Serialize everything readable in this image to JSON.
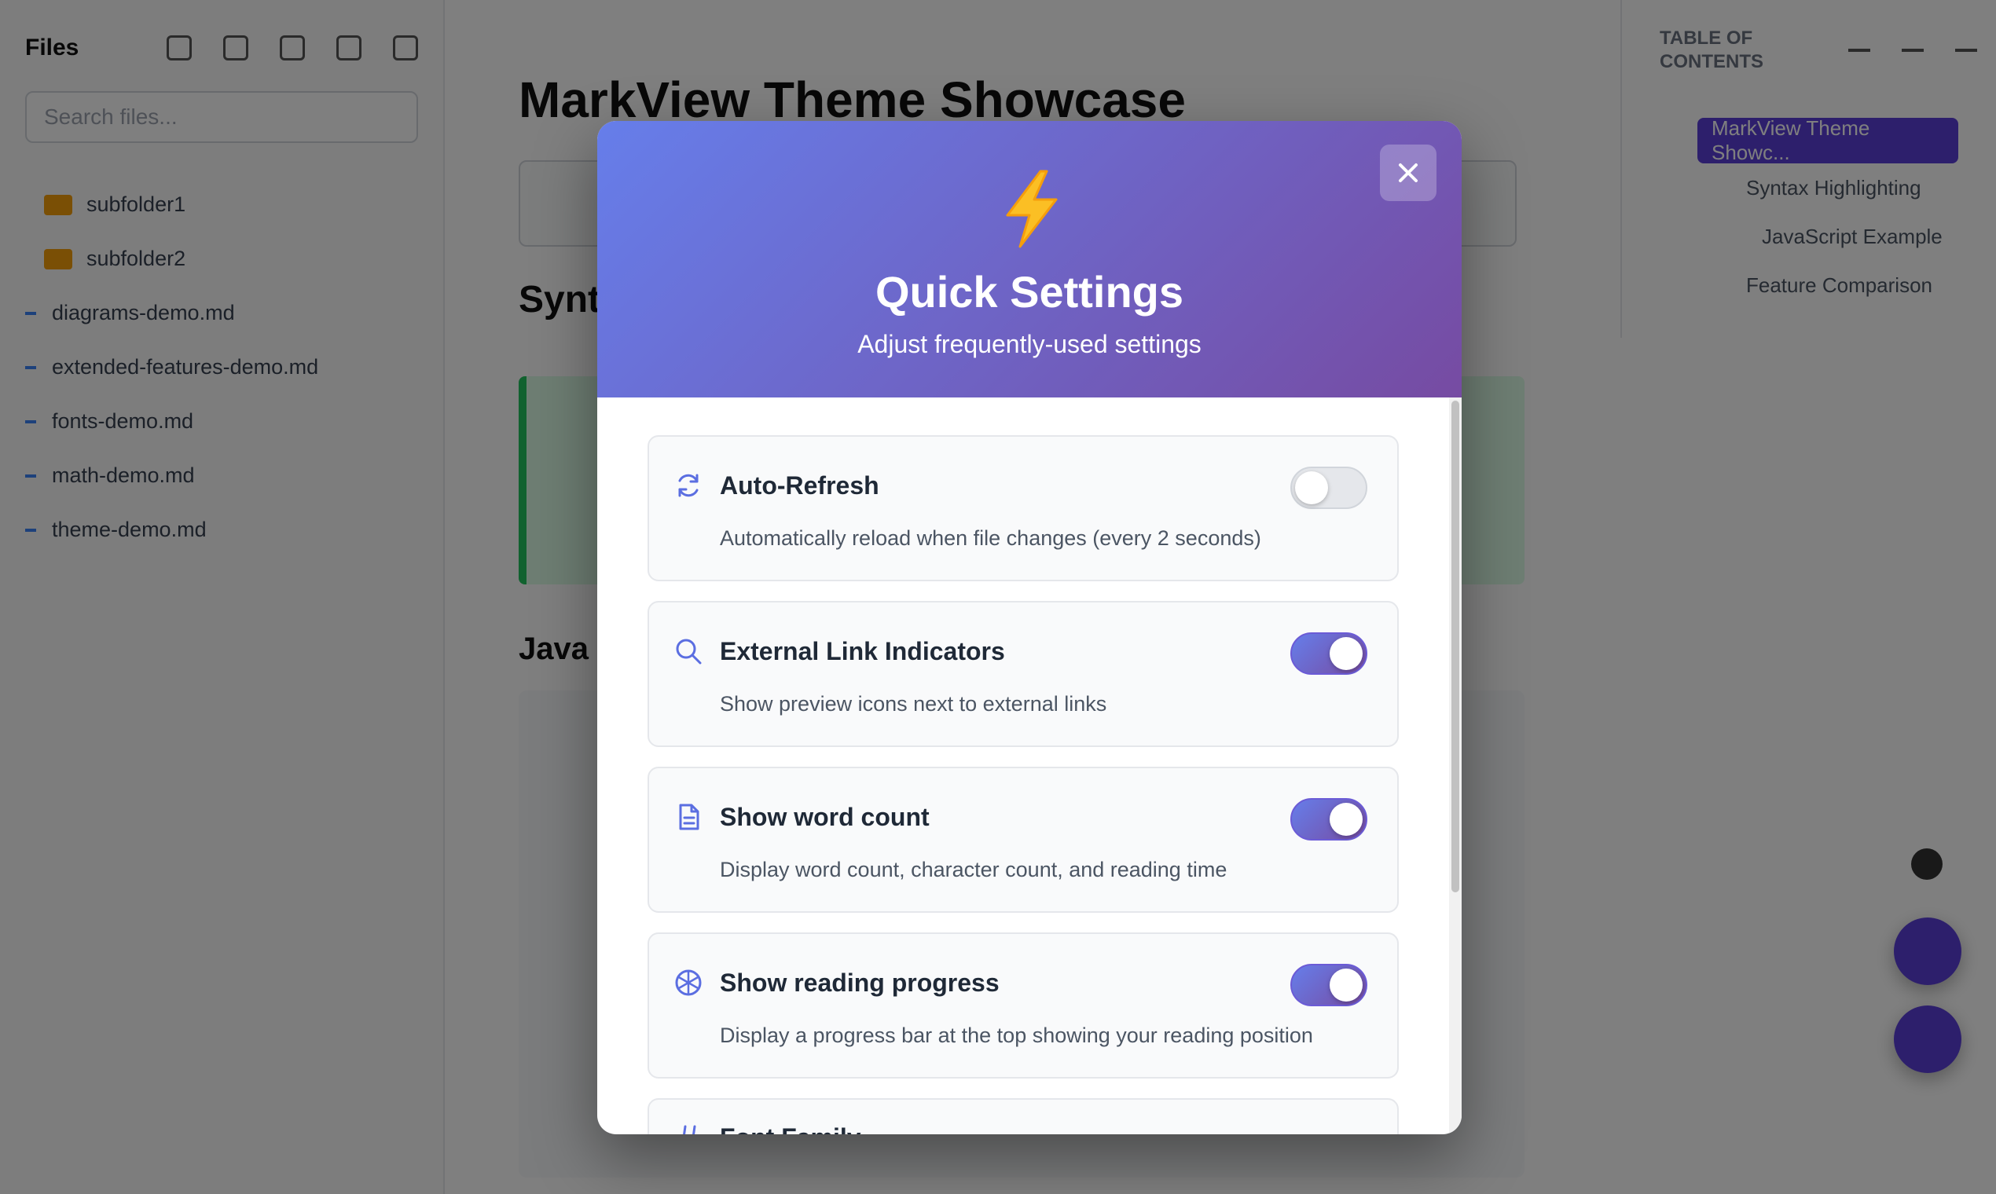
{
  "sidebar": {
    "title": "Files",
    "search_placeholder": "Search files...",
    "tree": [
      {
        "label": "subfolder1",
        "type": "folder"
      },
      {
        "label": "subfolder2",
        "type": "folder"
      },
      {
        "label": "diagrams-demo.md",
        "type": "file"
      },
      {
        "label": "extended-features-demo.md",
        "type": "file"
      },
      {
        "label": "fonts-demo.md",
        "type": "file"
      },
      {
        "label": "math-demo.md",
        "type": "file"
      },
      {
        "label": "theme-demo.md",
        "type": "file"
      }
    ]
  },
  "document": {
    "title": "MarkView Theme Showcase",
    "h2": "Synt",
    "h3": "Java"
  },
  "toc": {
    "title": "TABLE OF CONTENTS",
    "active": "MarkView Theme Showc...",
    "links": [
      "Syntax Highlighting",
      "JavaScript Example",
      "Feature Comparison"
    ]
  },
  "modal": {
    "title": "Quick Settings",
    "subtitle": "Adjust frequently-used settings",
    "close_icon": "close-icon",
    "settings": [
      {
        "title": "Auto-Refresh",
        "description": "Automatically reload when file changes (every 2 seconds)",
        "icon": "refresh-icon",
        "enabled": false
      },
      {
        "title": "External Link Indicators",
        "description": "Show preview icons next to external links",
        "icon": "search-icon",
        "enabled": true
      },
      {
        "title": "Show word count",
        "description": "Display word count, character count, and reading time",
        "icon": "document-icon",
        "enabled": true
      },
      {
        "title": "Show reading progress",
        "description": "Display a progress bar at the top showing your reading position",
        "icon": "aperture-icon",
        "enabled": true
      },
      {
        "title": "Font Family",
        "icon": "hash-icon"
      }
    ]
  },
  "colors": {
    "gradient_start": "#667eea",
    "gradient_end": "#764ba2",
    "accent": "#5b3fd9"
  }
}
